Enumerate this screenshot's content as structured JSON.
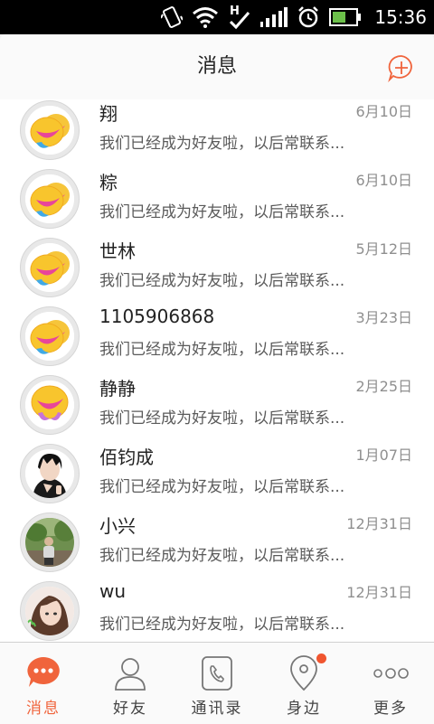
{
  "status_bar": {
    "time": "15:36",
    "network": "H"
  },
  "header": {
    "title": "消息"
  },
  "conversations": [
    {
      "name": "翔",
      "date": "6月10日",
      "preview": "我们已经成为好友啦，以后常联系...",
      "avatar": "qq-double-icon"
    },
    {
      "name": "粽",
      "date": "6月10日",
      "preview": "我们已经成为好友啦，以后常联系...",
      "avatar": "qq-double-icon"
    },
    {
      "name": "世林",
      "date": "5月12日",
      "preview": "我们已经成为好友啦，以后常联系...",
      "avatar": "qq-double-icon"
    },
    {
      "name": "1105906868",
      "date": "3月23日",
      "preview": "我们已经成为好友啦，以后常联系...",
      "avatar": "qq-double-icon"
    },
    {
      "name": "静静",
      "date": "2月25日",
      "preview": "我们已经成为好友啦，以后常联系...",
      "avatar": "qq-single-icon"
    },
    {
      "name": "佰钧成",
      "date": "1月07日",
      "preview": "我们已经成为好友啦，以后常联系...",
      "avatar": "anime-avatar"
    },
    {
      "name": "小兴",
      "date": "12月31日",
      "preview": "我们已经成为好友啦，以后常联系...",
      "avatar": "photo-avatar"
    },
    {
      "name": "wu",
      "date": "12月31日",
      "preview": "我们已经成为好友啦，以后常联系...",
      "avatar": "photo-avatar-girl"
    }
  ],
  "tabs": [
    {
      "label": "消息",
      "icon": "chat-bubble-icon",
      "active": true
    },
    {
      "label": "好友",
      "icon": "person-icon",
      "active": false
    },
    {
      "label": "通讯录",
      "icon": "phone-book-icon",
      "active": false
    },
    {
      "label": "身边",
      "icon": "location-pin-icon",
      "active": false,
      "badge": true
    },
    {
      "label": "更多",
      "icon": "more-dots-icon",
      "active": false
    }
  ],
  "colors": {
    "accent": "#f0643c",
    "badge": "#f0552f"
  }
}
